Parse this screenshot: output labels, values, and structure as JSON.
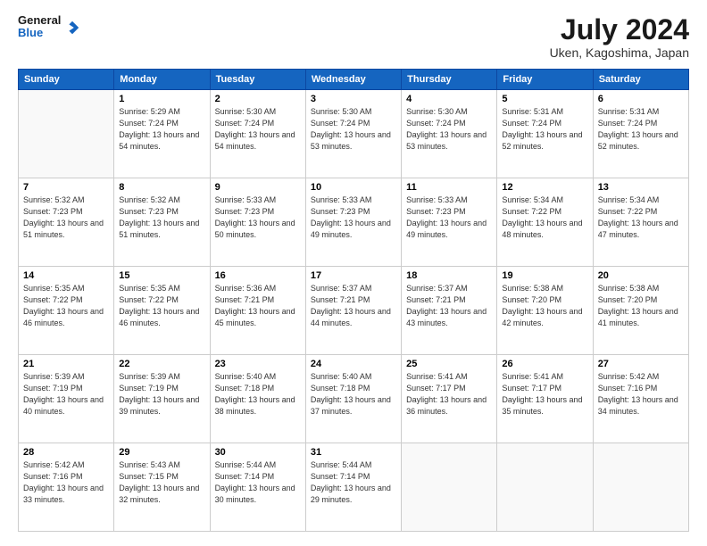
{
  "header": {
    "logo_general": "General",
    "logo_blue": "Blue",
    "title": "July 2024",
    "subtitle": "Uken, Kagoshima, Japan"
  },
  "weekdays": [
    "Sunday",
    "Monday",
    "Tuesday",
    "Wednesday",
    "Thursday",
    "Friday",
    "Saturday"
  ],
  "weeks": [
    [
      {
        "day": "",
        "sunrise": "",
        "sunset": "",
        "daylight": ""
      },
      {
        "day": "1",
        "sunrise": "Sunrise: 5:29 AM",
        "sunset": "Sunset: 7:24 PM",
        "daylight": "Daylight: 13 hours and 54 minutes."
      },
      {
        "day": "2",
        "sunrise": "Sunrise: 5:30 AM",
        "sunset": "Sunset: 7:24 PM",
        "daylight": "Daylight: 13 hours and 54 minutes."
      },
      {
        "day": "3",
        "sunrise": "Sunrise: 5:30 AM",
        "sunset": "Sunset: 7:24 PM",
        "daylight": "Daylight: 13 hours and 53 minutes."
      },
      {
        "day": "4",
        "sunrise": "Sunrise: 5:30 AM",
        "sunset": "Sunset: 7:24 PM",
        "daylight": "Daylight: 13 hours and 53 minutes."
      },
      {
        "day": "5",
        "sunrise": "Sunrise: 5:31 AM",
        "sunset": "Sunset: 7:24 PM",
        "daylight": "Daylight: 13 hours and 52 minutes."
      },
      {
        "day": "6",
        "sunrise": "Sunrise: 5:31 AM",
        "sunset": "Sunset: 7:24 PM",
        "daylight": "Daylight: 13 hours and 52 minutes."
      }
    ],
    [
      {
        "day": "7",
        "sunrise": "Sunrise: 5:32 AM",
        "sunset": "Sunset: 7:23 PM",
        "daylight": "Daylight: 13 hours and 51 minutes."
      },
      {
        "day": "8",
        "sunrise": "Sunrise: 5:32 AM",
        "sunset": "Sunset: 7:23 PM",
        "daylight": "Daylight: 13 hours and 51 minutes."
      },
      {
        "day": "9",
        "sunrise": "Sunrise: 5:33 AM",
        "sunset": "Sunset: 7:23 PM",
        "daylight": "Daylight: 13 hours and 50 minutes."
      },
      {
        "day": "10",
        "sunrise": "Sunrise: 5:33 AM",
        "sunset": "Sunset: 7:23 PM",
        "daylight": "Daylight: 13 hours and 49 minutes."
      },
      {
        "day": "11",
        "sunrise": "Sunrise: 5:33 AM",
        "sunset": "Sunset: 7:23 PM",
        "daylight": "Daylight: 13 hours and 49 minutes."
      },
      {
        "day": "12",
        "sunrise": "Sunrise: 5:34 AM",
        "sunset": "Sunset: 7:22 PM",
        "daylight": "Daylight: 13 hours and 48 minutes."
      },
      {
        "day": "13",
        "sunrise": "Sunrise: 5:34 AM",
        "sunset": "Sunset: 7:22 PM",
        "daylight": "Daylight: 13 hours and 47 minutes."
      }
    ],
    [
      {
        "day": "14",
        "sunrise": "Sunrise: 5:35 AM",
        "sunset": "Sunset: 7:22 PM",
        "daylight": "Daylight: 13 hours and 46 minutes."
      },
      {
        "day": "15",
        "sunrise": "Sunrise: 5:35 AM",
        "sunset": "Sunset: 7:22 PM",
        "daylight": "Daylight: 13 hours and 46 minutes."
      },
      {
        "day": "16",
        "sunrise": "Sunrise: 5:36 AM",
        "sunset": "Sunset: 7:21 PM",
        "daylight": "Daylight: 13 hours and 45 minutes."
      },
      {
        "day": "17",
        "sunrise": "Sunrise: 5:37 AM",
        "sunset": "Sunset: 7:21 PM",
        "daylight": "Daylight: 13 hours and 44 minutes."
      },
      {
        "day": "18",
        "sunrise": "Sunrise: 5:37 AM",
        "sunset": "Sunset: 7:21 PM",
        "daylight": "Daylight: 13 hours and 43 minutes."
      },
      {
        "day": "19",
        "sunrise": "Sunrise: 5:38 AM",
        "sunset": "Sunset: 7:20 PM",
        "daylight": "Daylight: 13 hours and 42 minutes."
      },
      {
        "day": "20",
        "sunrise": "Sunrise: 5:38 AM",
        "sunset": "Sunset: 7:20 PM",
        "daylight": "Daylight: 13 hours and 41 minutes."
      }
    ],
    [
      {
        "day": "21",
        "sunrise": "Sunrise: 5:39 AM",
        "sunset": "Sunset: 7:19 PM",
        "daylight": "Daylight: 13 hours and 40 minutes."
      },
      {
        "day": "22",
        "sunrise": "Sunrise: 5:39 AM",
        "sunset": "Sunset: 7:19 PM",
        "daylight": "Daylight: 13 hours and 39 minutes."
      },
      {
        "day": "23",
        "sunrise": "Sunrise: 5:40 AM",
        "sunset": "Sunset: 7:18 PM",
        "daylight": "Daylight: 13 hours and 38 minutes."
      },
      {
        "day": "24",
        "sunrise": "Sunrise: 5:40 AM",
        "sunset": "Sunset: 7:18 PM",
        "daylight": "Daylight: 13 hours and 37 minutes."
      },
      {
        "day": "25",
        "sunrise": "Sunrise: 5:41 AM",
        "sunset": "Sunset: 7:17 PM",
        "daylight": "Daylight: 13 hours and 36 minutes."
      },
      {
        "day": "26",
        "sunrise": "Sunrise: 5:41 AM",
        "sunset": "Sunset: 7:17 PM",
        "daylight": "Daylight: 13 hours and 35 minutes."
      },
      {
        "day": "27",
        "sunrise": "Sunrise: 5:42 AM",
        "sunset": "Sunset: 7:16 PM",
        "daylight": "Daylight: 13 hours and 34 minutes."
      }
    ],
    [
      {
        "day": "28",
        "sunrise": "Sunrise: 5:42 AM",
        "sunset": "Sunset: 7:16 PM",
        "daylight": "Daylight: 13 hours and 33 minutes."
      },
      {
        "day": "29",
        "sunrise": "Sunrise: 5:43 AM",
        "sunset": "Sunset: 7:15 PM",
        "daylight": "Daylight: 13 hours and 32 minutes."
      },
      {
        "day": "30",
        "sunrise": "Sunrise: 5:44 AM",
        "sunset": "Sunset: 7:14 PM",
        "daylight": "Daylight: 13 hours and 30 minutes."
      },
      {
        "day": "31",
        "sunrise": "Sunrise: 5:44 AM",
        "sunset": "Sunset: 7:14 PM",
        "daylight": "Daylight: 13 hours and 29 minutes."
      },
      {
        "day": "",
        "sunrise": "",
        "sunset": "",
        "daylight": ""
      },
      {
        "day": "",
        "sunrise": "",
        "sunset": "",
        "daylight": ""
      },
      {
        "day": "",
        "sunrise": "",
        "sunset": "",
        "daylight": ""
      }
    ]
  ]
}
